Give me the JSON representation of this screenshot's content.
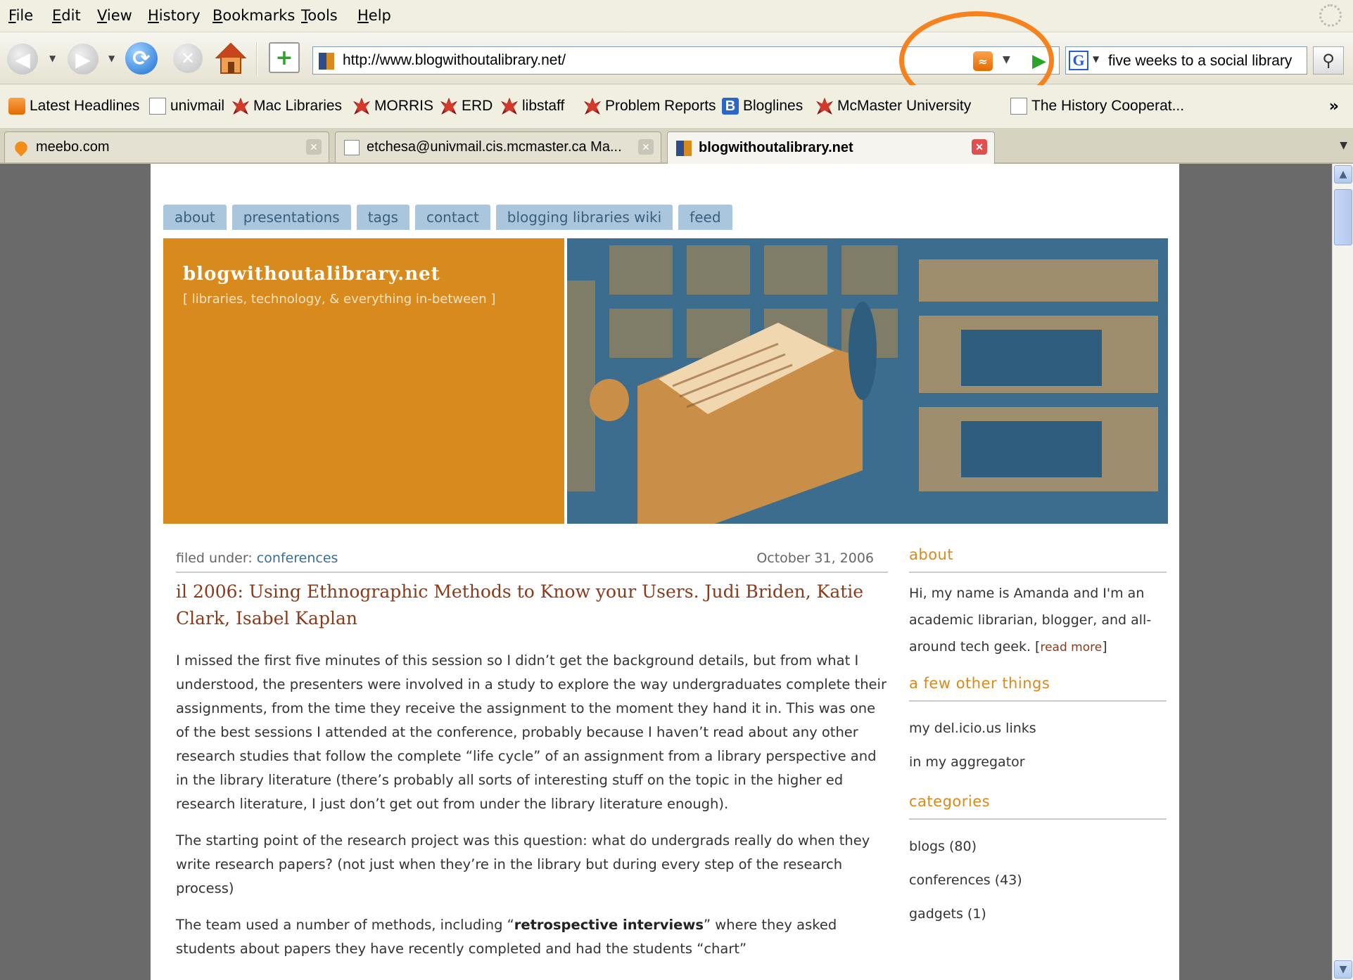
{
  "menubar": {
    "items": [
      "File",
      "Edit",
      "View",
      "History",
      "Bookmarks",
      "Tools",
      "Help"
    ]
  },
  "navbar": {
    "url": "http://www.blogwithoutalibrary.net/",
    "search_value": "five weeks to a social library",
    "search_engine_icon": "google-icon",
    "icons": [
      "back-arrow-icon",
      "forward-arrow-icon",
      "reload-icon",
      "stop-icon",
      "home-icon",
      "new-tab-icon",
      "rss-feed-icon",
      "go-icon",
      "magnifier-icon"
    ]
  },
  "annotation": {
    "color": "#f5821f",
    "shape": "circle-around-rss-feed-icon"
  },
  "bookmarks": {
    "items": [
      {
        "label": "Latest Headlines",
        "icon": "feed-icon"
      },
      {
        "label": "univmail",
        "icon": "page-icon"
      },
      {
        "label": "Mac Libraries",
        "icon": "mcmaster-icon"
      },
      {
        "label": "MORRIS",
        "icon": "mcmaster-icon"
      },
      {
        "label": "ERD",
        "icon": "mcmaster-icon"
      },
      {
        "label": "libstaff",
        "icon": "mcmaster-icon"
      },
      {
        "label": "Problem Reports",
        "icon": "mcmaster-icon"
      },
      {
        "label": "Bloglines",
        "icon": "bloglines-icon"
      },
      {
        "label": "McMaster University",
        "icon": "mcmaster-icon"
      },
      {
        "label": "The History Cooperat...",
        "icon": "page-icon"
      }
    ],
    "more": "»"
  },
  "tabs": [
    {
      "label": "meebo.com",
      "active": false
    },
    {
      "label": "etchesa@univmail.cis.mcmaster.ca Ma...",
      "active": false
    },
    {
      "label": "blogwithoutalibrary.net",
      "active": true
    }
  ],
  "site": {
    "nav": [
      "about",
      "presentations",
      "tags",
      "contact",
      "blogging libraries wiki",
      "feed"
    ],
    "title": "blogwithoutalibrary.net",
    "tagline": "[ libraries, technology, & everything in-between ]",
    "colors": {
      "orange": "#d98a1c",
      "blue": "#3c6d8e",
      "title_red": "#8b3a1a"
    }
  },
  "post": {
    "filed_label": "filed under:",
    "category": "conferences",
    "date": "October 31, 2006",
    "title": "il 2006: Using Ethnographic Methods to Know your Users. Judi Briden, Katie Clark, Isabel Kaplan",
    "p1": "I missed the first five minutes of this session so I didn’t get the background details, but from what I understood, the presenters were involved in a study to explore the way undergraduates complete their assignments, from the time they receive the assignment to the moment they hand it in. This was one of the best sessions I attended at the conference, probably because I haven’t read about any other research studies that follow the complete “life cycle” of an assignment from a library perspective and in the library literature (there’s probably all sorts of interesting stuff on the topic in the higher ed research literature, I just don’t get out from under the library literature enough).",
    "p2": "The starting point of the research project was this question: what do undergrads really do when they write research papers? (not just when they’re in the library but during every step of the research process)",
    "p3_start": "The team used a number of methods, including “",
    "p3_bold": "retrospective interviews",
    "p3_end": "” where they asked students about papers they have recently completed and had the students “chart”"
  },
  "sidebar": {
    "about_head": "about",
    "about_text": "Hi, my name is Amanda and I'm an academic librarian, blogger, and all-around tech geek. [",
    "about_more": "read more",
    "about_close": "]",
    "other_head": "a few other things",
    "other_items": [
      "my del.icio.us links",
      "in my aggregator"
    ],
    "categories_head": "categories",
    "categories": [
      {
        "name": "blogs",
        "count": "(80)"
      },
      {
        "name": "conferences",
        "count": "(43)"
      },
      {
        "name": "gadgets",
        "count": "(1)"
      }
    ]
  }
}
